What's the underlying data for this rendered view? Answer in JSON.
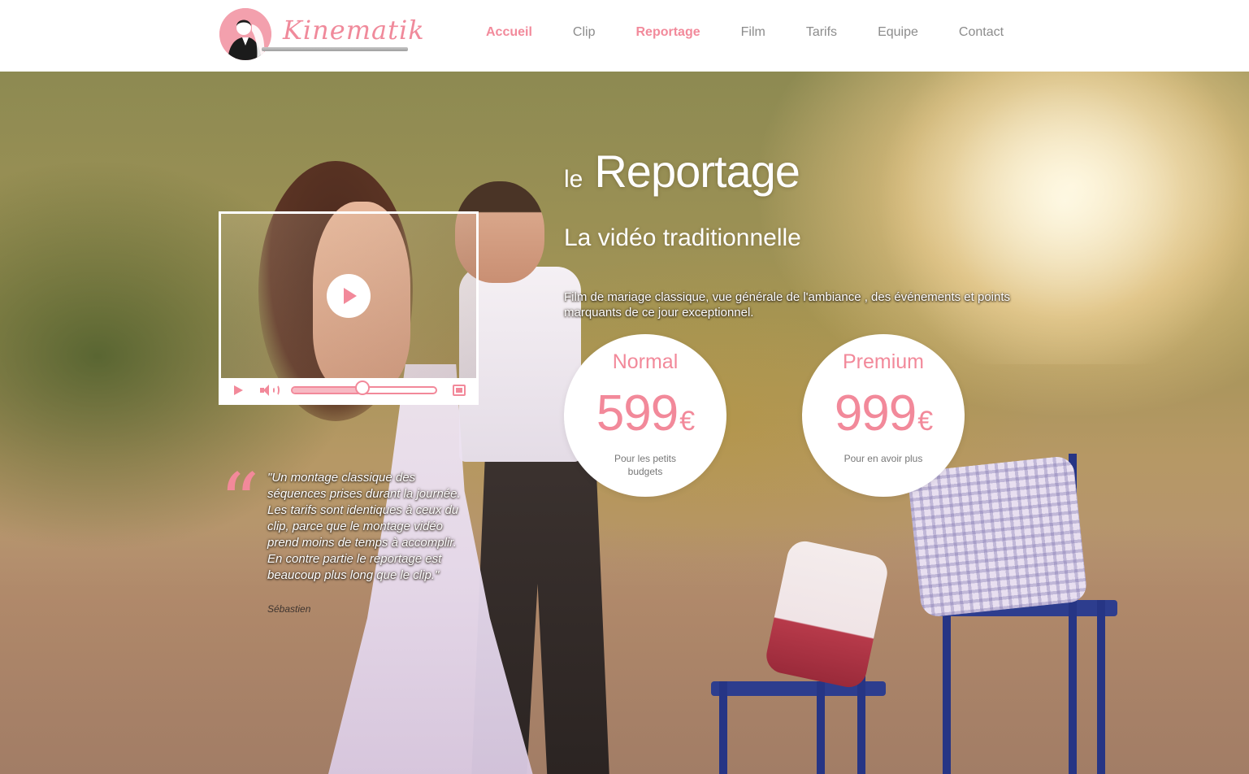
{
  "brand": {
    "name": "Kinematik",
    "accent_color": "#f2899a"
  },
  "nav": {
    "items": [
      {
        "label": "Accueil",
        "active": true
      },
      {
        "label": "Clip",
        "active": false
      },
      {
        "label": "Reportage",
        "active": true
      },
      {
        "label": "Film",
        "active": false
      },
      {
        "label": "Tarifs",
        "active": false
      },
      {
        "label": "Equipe",
        "active": false
      },
      {
        "label": "Contact",
        "active": false
      }
    ]
  },
  "hero": {
    "title_prefix": "le",
    "title": "Reportage",
    "subtitle": "La vidéo traditionnelle",
    "description": "Film de mariage classique, vue générale de l'ambiance , des événements et points marquants de ce jour exceptionnel."
  },
  "video_player": {
    "progress": 0.5,
    "icons": [
      "play-icon",
      "volume-icon",
      "fullscreen-icon"
    ]
  },
  "pricing": [
    {
      "name": "Normal",
      "amount": "599",
      "currency": "€",
      "note": "Pour les petits budgets"
    },
    {
      "name": "Premium",
      "amount": "999",
      "currency": "€",
      "note": "Pour en avoir plus"
    }
  ],
  "testimonial": {
    "quote_mark": "“",
    "text": "\"Un montage classique des séquences prises durant la journée. Les tarifs sont identiques à ceux du clip, parce que le montage vidéo prend moins de temps à accomplir. En contre partie le reportage est beaucoup plus long que le clip.\"",
    "author": "Sébastien"
  }
}
